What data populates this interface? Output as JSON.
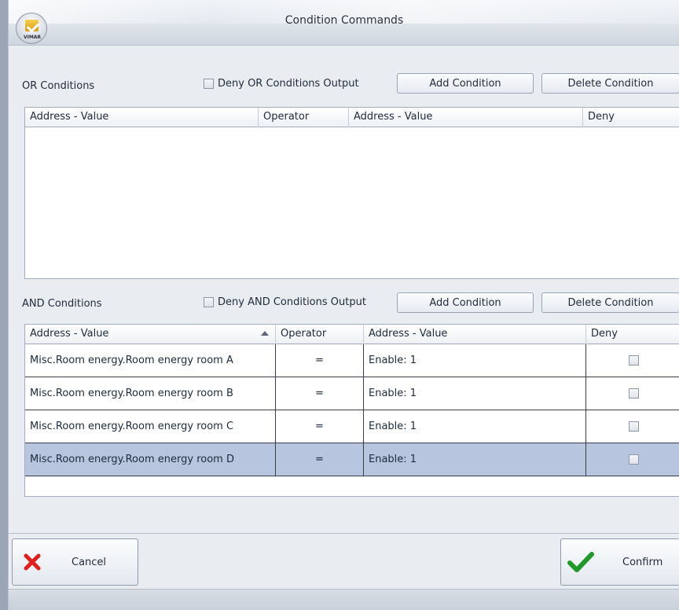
{
  "window": {
    "title": "Condition Commands",
    "logo_text": "VIMAR"
  },
  "or_section": {
    "label": "OR Conditions",
    "deny_label": "Deny OR Conditions Output",
    "add_label": "Add Condition",
    "delete_label": "Delete Condition",
    "columns": [
      "Address - Value",
      "Operator",
      "Address - Value",
      "Deny"
    ]
  },
  "and_section": {
    "label": "AND Conditions",
    "deny_label": "Deny AND Conditions Output",
    "add_label": "Add Condition",
    "delete_label": "Delete Condition",
    "columns": [
      "Address - Value",
      "Operator",
      "Address - Value",
      "Deny"
    ],
    "rows": [
      {
        "address": "Misc.Room energy.Room energy room A",
        "operator": "=",
        "value": "Enable: 1",
        "deny": false
      },
      {
        "address": "Misc.Room energy.Room energy room B",
        "operator": "=",
        "value": "Enable: 1",
        "deny": false
      },
      {
        "address": "Misc.Room energy.Room energy room C",
        "operator": "=",
        "value": "Enable: 1",
        "deny": false
      },
      {
        "address": "Misc.Room energy.Room energy room D",
        "operator": "=",
        "value": "Enable: 1",
        "deny": false
      }
    ],
    "selected_row": 3
  },
  "footer": {
    "cancel_label": "Cancel",
    "confirm_label": "Confirm"
  },
  "colors": {
    "selected_row": "#b7c5de",
    "cancel_icon": "#e0201b",
    "confirm_icon": "#1f9a2a"
  },
  "icons": {
    "cancel": "close-x-icon",
    "confirm": "checkmark-icon",
    "sort": "sort-ascending-icon"
  }
}
